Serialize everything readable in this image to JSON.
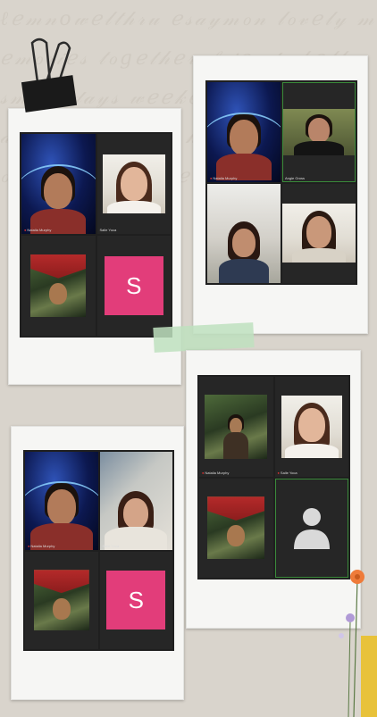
{
  "participants": {
    "p1": {
      "name": "Natalia Murphy"
    },
    "p2": {
      "name": "Salle Yoca"
    },
    "p3": {
      "name": "Angie Gross"
    },
    "p4": {
      "name": "Natalia Murphy"
    },
    "p5": {
      "name": "Salle Yoca"
    },
    "s_label": "S"
  },
  "colors": {
    "tile_bg": "#262626",
    "s_avatar": "#e23d7a",
    "active_border": "#3a8a3a",
    "background": "#d9d4cc",
    "polaroid": "#f6f6f4"
  },
  "icons": [
    "binder-clip-icon",
    "mic-off-icon",
    "person-avatar-icon",
    "flower-icon"
  ]
}
